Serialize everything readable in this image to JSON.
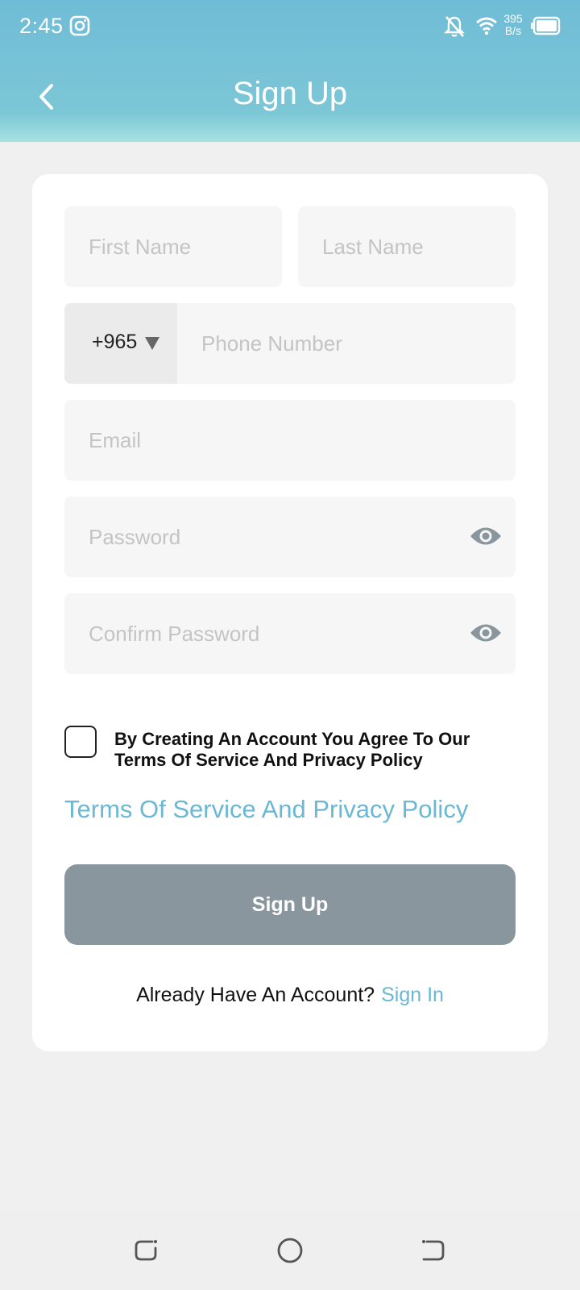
{
  "status_bar": {
    "time": "2:45",
    "speed_value": "395",
    "speed_unit": "B/s",
    "icons": [
      "instagram-icon",
      "notifications-off-icon",
      "wifi-icon",
      "battery-icon"
    ]
  },
  "header": {
    "title": "Sign Up",
    "back_icon": "chevron-left-icon",
    "background_color": "#7cc4d8"
  },
  "form": {
    "first_name_placeholder": "First Name",
    "last_name_placeholder": "Last Name",
    "country_code": "+965",
    "phone_placeholder": "Phone Number",
    "email_placeholder": "Email",
    "password_placeholder": "Password",
    "confirm_password_placeholder": "Confirm Password",
    "agreement_text": "By Creating An Account You Agree To Our Terms Of Service And Privacy Policy",
    "agreement_checked": false,
    "terms_link": "Terms Of Service And Privacy Policy",
    "submit_label": "Sign Up",
    "submit_color": "#8a969e",
    "already_text": "Already Have An Account?",
    "sign_in_link": "Sign In",
    "accent_color": "#6ab8d3"
  },
  "nav_bar": {
    "icons": [
      "recent-apps-icon",
      "home-icon",
      "back-icon"
    ]
  }
}
